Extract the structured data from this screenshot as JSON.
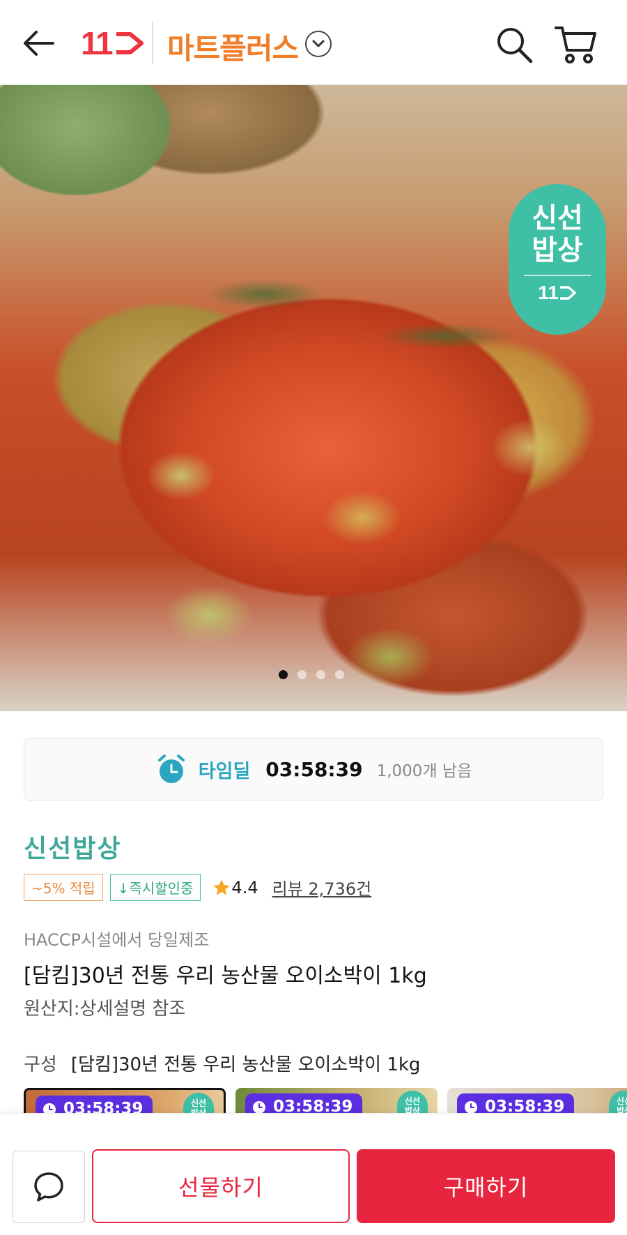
{
  "header": {
    "logo_text": "11",
    "store_title": "마트플러스"
  },
  "hero": {
    "badge_line1": "신선",
    "badge_line2": "밥상",
    "badge_logo": "11",
    "carousel_total": 4,
    "carousel_active": 1
  },
  "timedeal": {
    "label": "타임딜",
    "time": "03:58:39",
    "remaining": "1,000개 남음"
  },
  "product": {
    "store": "신선밥상",
    "tag_points": "~5% 적립",
    "tag_discount": "↓즉시할인중",
    "rating": "4.4",
    "review": "리뷰 2,736건",
    "subtitle": "HACCP시설에서 당일제조",
    "title": "[담킴]30년 전통 우리 농산물 오이소박이 1kg",
    "origin": "원산지:상세설명 참조",
    "composition_label": "구성",
    "composition_value": "[담킴]30년 전통 우리 농산물 오이소박이 1kg"
  },
  "options": [
    {
      "timer": "03:58:39",
      "badge1": "신선",
      "badge2": "밥상"
    },
    {
      "timer": "03:58:39",
      "badge1": "신선",
      "badge2": "밥상"
    },
    {
      "timer": "03:58:39",
      "badge1": "신선",
      "badge2": "밥상"
    }
  ],
  "bottom": {
    "gift_label": "선물하기",
    "buy_label": "구매하기"
  },
  "colors": {
    "brand_red": "#e8253e",
    "mart_orange": "#f07f2a",
    "teal": "#3fa89a",
    "timer_purple": "#5b2ee0"
  },
  "icons": [
    "back-arrow-icon",
    "chevron-down-icon",
    "search-icon",
    "cart-icon",
    "alarm-clock-icon",
    "star-icon",
    "chat-bubble-icon"
  ]
}
